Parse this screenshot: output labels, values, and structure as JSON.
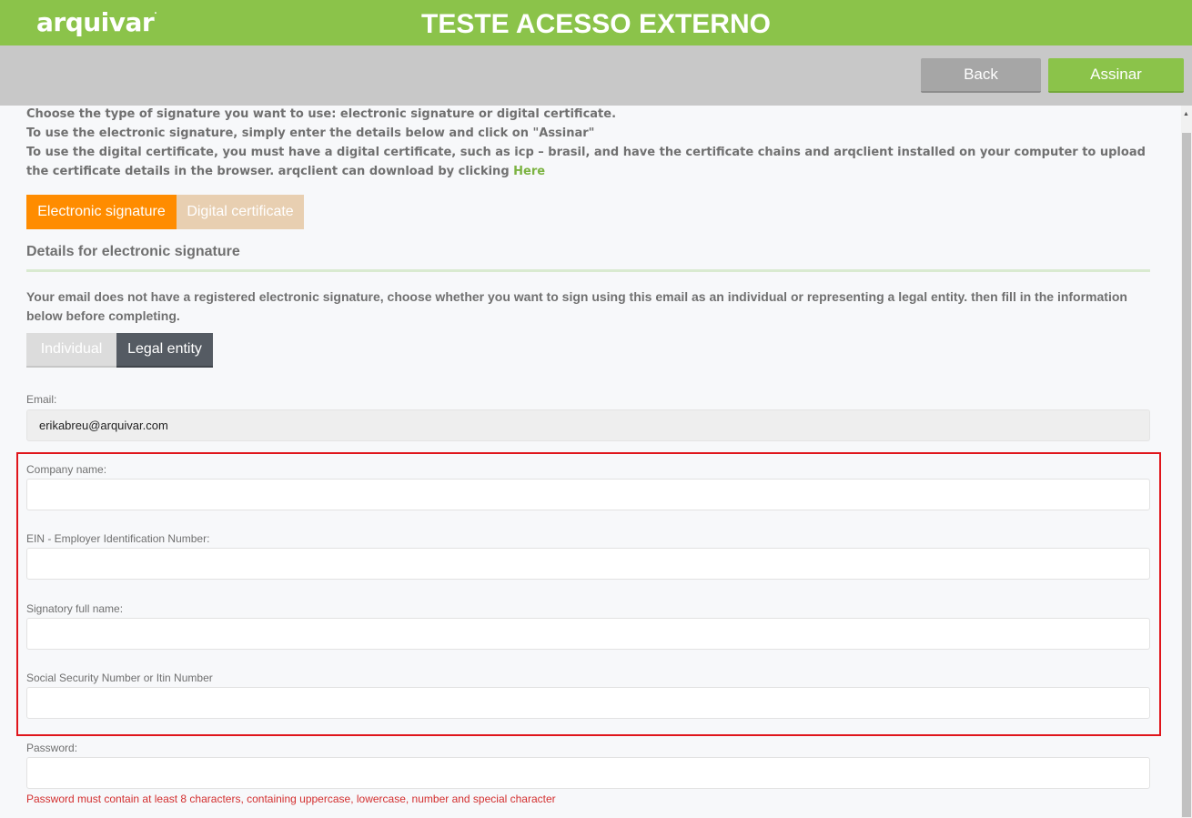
{
  "header": {
    "logo_text": "arquivar",
    "logo_mark": ".",
    "title": "TESTE ACESSO EXTERNO",
    "brand_color": "#8bc34a"
  },
  "toolbar": {
    "back_label": "Back",
    "sign_label": "Assinar"
  },
  "intro": {
    "line1": "Choose the type of signature you want to use: electronic signature or digital certificate.",
    "line2": "To use the electronic signature, simply enter the details below and click on \"Assinar\"",
    "line3": "To use the digital certificate, you must have a digital certificate, such as icp – brasil, and have the certificate chains and arqclient installed on your computer to upload the certificate details in the browser. arqclient can download by clicking",
    "here_link": "Here"
  },
  "signature_type": {
    "options": [
      "Electronic signature",
      "Digital certificate"
    ],
    "selected": "Electronic signature",
    "selected_color": "#ff8c00"
  },
  "section": {
    "title": "Details for electronic signature",
    "notice": "Your email does not have a registered electronic signature, choose whether you want to sign using this email as an individual or representing a legal entity. then fill in the information below before completing."
  },
  "signer_type": {
    "options": [
      "Individual",
      "Legal entity"
    ],
    "selected": "Legal entity"
  },
  "form": {
    "email": {
      "label": "Email:",
      "value": "erikabreu@arquivar.com"
    },
    "company_name": {
      "label": "Company name:",
      "value": ""
    },
    "ein": {
      "label": "EIN - Employer Identification Number:",
      "value": ""
    },
    "signatory_name": {
      "label": "Signatory full name:",
      "value": ""
    },
    "ssn": {
      "label": "Social Security Number or Itin Number",
      "value": ""
    },
    "password": {
      "label": "Password:",
      "value": ""
    },
    "password_hint": "Password must contain at least 8 characters, containing uppercase, lowercase, number and special character",
    "highlight_color": "#e0151b",
    "error_color": "#d32f2f"
  }
}
